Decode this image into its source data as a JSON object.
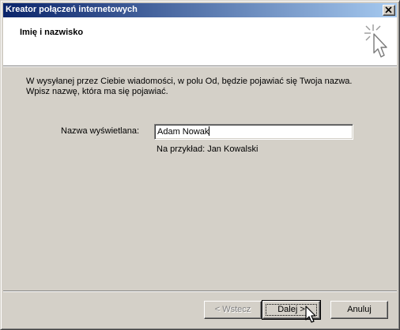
{
  "window": {
    "title": "Kreator połączeń internetowych"
  },
  "header": {
    "title": "Imię i nazwisko",
    "icon": "sparkle-pointer-icon"
  },
  "body": {
    "description_line1": "W wysyłanej przez Ciebie wiadomości, w polu Od, będzie pojawiać się Twoja nazwa.",
    "description_line2": "Wpisz nazwę, która ma się pojawiać.",
    "display_name_label": "Nazwa wyświetlana:",
    "display_name_value": "Adam Nowak",
    "example": "Na przykład: Jan Kowalski"
  },
  "buttons": {
    "back": "< Wstecz",
    "next": "Dalej >",
    "cancel": "Anuluj"
  },
  "colors": {
    "titlebar_start": "#0a246a",
    "titlebar_end": "#a6caf0",
    "dialog_bg": "#d4d0c8"
  }
}
